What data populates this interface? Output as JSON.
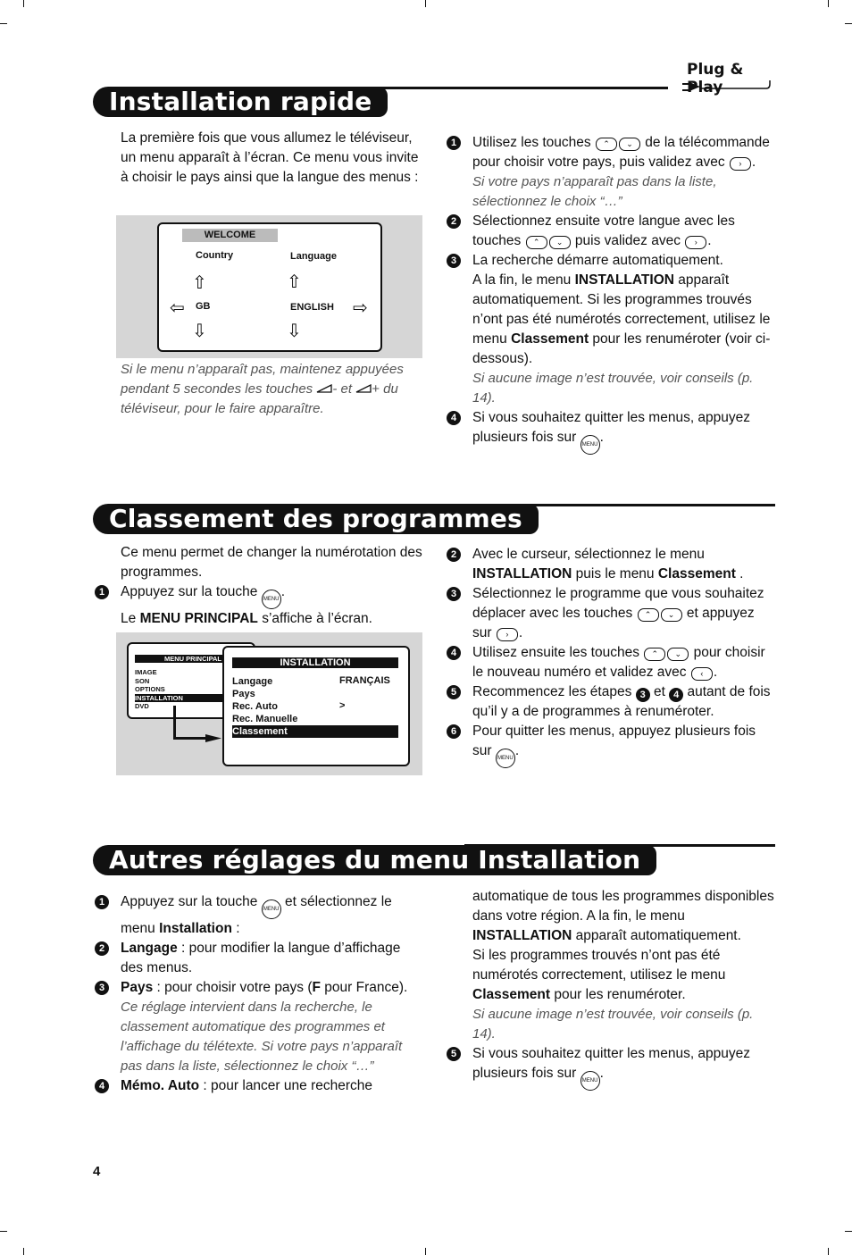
{
  "page_number": "4",
  "logo_text": "Plug & Play",
  "colors": {
    "ink": "#111111",
    "note": "#555555",
    "screen_bg": "#d6d6d6"
  },
  "sections": [
    {
      "title": "Installation rapide",
      "left": [
        {
          "segs": [
            "La première fois que vous allumez le téléviseur, un menu apparaît à l’écran. Ce menu vous invite à choisir le pays ainsi que la langue des menus :"
          ]
        }
      ],
      "left_note": [
        {
          "segs": [
            {
              "i": "Si le menu n’apparaît pas, maintenez appuyées pendant 5 secondes les touches "
            },
            {
              "vol": "minus"
            },
            {
              "i": "- et "
            },
            {
              "vol": "plus"
            },
            {
              "i": "+ du téléviseur, pour le faire apparaître."
            }
          ]
        }
      ],
      "right": [
        {
          "n": "1",
          "segs": [
            "Utilisez les touches ",
            {
              "key": "up"
            },
            {
              "key": "down"
            },
            " de la télécommande pour choisir votre pays, puis validez avec ",
            {
              "key": "right"
            },
            ".",
            {
              "br": 1
            },
            {
              "i": "Si votre pays n’apparaît pas dans la liste, sélectionnez le choix “…”"
            }
          ]
        },
        {
          "n": "2",
          "segs": [
            "Sélectionnez ensuite votre langue avec les touches ",
            {
              "key": "up"
            },
            {
              "key": "down"
            },
            " puis validez avec ",
            {
              "key": "right"
            },
            "."
          ]
        },
        {
          "n": "3",
          "segs": [
            "La recherche démarre automatiquement.",
            {
              "br": 1
            },
            "A la fin, le menu ",
            {
              "b": "INSTALLATION"
            },
            " apparaît automatiquement. Si les programmes trouvés n’ont pas été numérotés correctement, utilisez le menu ",
            {
              "b": "Classement"
            },
            " pour les renuméroter (voir ci-dessous).",
            {
              "br": 1
            },
            {
              "i": "Si aucune image n’est trouvée, voir conseils (p. 14)."
            }
          ]
        },
        {
          "n": "4",
          "segs": [
            "Si vous souhaitez quitter les menus, appuyez plusieurs fois sur ",
            {
              "menu": 1
            },
            "."
          ]
        }
      ]
    },
    {
      "title": "Classement des programmes",
      "left": [
        {
          "segs": [
            "Ce menu permet de changer la numérotation des programmes."
          ]
        },
        {
          "n": "1",
          "segs": [
            "Appuyez sur la touche ",
            {
              "menu": 1
            },
            ".",
            {
              "br": 1
            },
            "Le ",
            {
              "b": "MENU PRINCIPAL"
            },
            " s’affiche à l’écran."
          ]
        }
      ],
      "right": [
        {
          "n": "2",
          "segs": [
            "Avec le curseur, sélectionnez le menu ",
            {
              "b": "INSTALLATION"
            },
            " puis le menu ",
            {
              "b": "Classement"
            },
            " ."
          ]
        },
        {
          "n": "3",
          "segs": [
            "Sélectionnez le programme que vous souhaitez déplacer avec les touches ",
            {
              "key": "up"
            },
            {
              "key": "down"
            },
            " et appuyez sur ",
            {
              "key": "right"
            },
            "."
          ]
        },
        {
          "n": "4",
          "segs": [
            "Utilisez ensuite les touches ",
            {
              "key": "up"
            },
            {
              "key": "down"
            },
            " pour choisir le nouveau numéro et validez avec ",
            {
              "key": "left"
            },
            "."
          ]
        },
        {
          "n": "5",
          "segs": [
            "Recommencez les étapes ",
            {
              "inum": "3"
            },
            " et ",
            {
              "inum": "4"
            },
            " autant de fois qu’il y a de programmes à renuméroter."
          ]
        },
        {
          "n": "6",
          "segs": [
            "Pour quitter les menus, appuyez plusieurs fois sur ",
            {
              "menu": 1
            },
            "."
          ]
        }
      ]
    },
    {
      "title": "Autres réglages du menu Installation",
      "left": [
        {
          "n": "1",
          "segs": [
            "Appuyez sur la touche ",
            {
              "menu": 1
            },
            " et sélectionnez le menu ",
            {
              "b": "Installation"
            },
            " :"
          ]
        },
        {
          "n": "2",
          "segs": [
            {
              "b": "Langage"
            },
            " : pour modifier la langue d’affichage des menus."
          ]
        },
        {
          "n": "3",
          "segs": [
            {
              "b": "Pays"
            },
            " : pour choisir votre pays (",
            {
              "b": "F"
            },
            " pour France).",
            {
              "br": 1
            },
            {
              "i": "Ce réglage intervient dans la recherche, le classement automatique des programmes et l’affichage du télétexte. Si votre pays n’apparaît pas dans la liste, sélectionnez le choix “…”"
            }
          ]
        },
        {
          "n": "4",
          "segs": [
            {
              "b": "Mémo. Auto"
            },
            " : pour lancer une recherche"
          ]
        }
      ],
      "right": [
        {
          "segs": [
            "automatique de tous les programmes disponibles dans votre région. A la fin, le menu ",
            {
              "b": "INSTALLATION"
            },
            " apparaît automatiquement.",
            {
              "br": 1
            },
            "Si les programmes trouvés n’ont pas été numérotés correctement, utilisez le menu ",
            {
              "b": "Classement"
            },
            " pour les renuméroter.",
            {
              "br": 1
            },
            {
              "i": "Si aucune image n’est trouvée, voir conseils (p. 14)."
            }
          ]
        },
        {
          "n": "5",
          "segs": [
            "Si vous souhaitez quitter les menus, appuyez plusieurs fois sur ",
            {
              "menu": 1
            },
            "."
          ]
        }
      ]
    }
  ],
  "welcome_screen": {
    "header": "WELCOME",
    "country_label": "Country",
    "language_label": "Language",
    "country_value": "GB",
    "language_value": "ENGLISH"
  },
  "menu_screen": {
    "main_title": "MENU PRINCIPAL",
    "main_items": [
      "IMAGE",
      "SON",
      "OPTIONS",
      "INSTALLATION",
      "DVD"
    ],
    "install_title": "INSTALLATION",
    "install_items": [
      "Langage",
      "Pays",
      "Rec. Auto",
      "Rec. Manuelle",
      "Classement"
    ],
    "langage_value": "FRANÇAIS",
    "rec_auto_value": ">"
  },
  "icons": {
    "key_up": "chevron-up",
    "key_down": "chevron-down",
    "key_right": "chevron-right",
    "key_left": "chevron-left",
    "menu": "menu-button",
    "vol_minus": "volume-minus",
    "vol_plus": "volume-plus"
  }
}
